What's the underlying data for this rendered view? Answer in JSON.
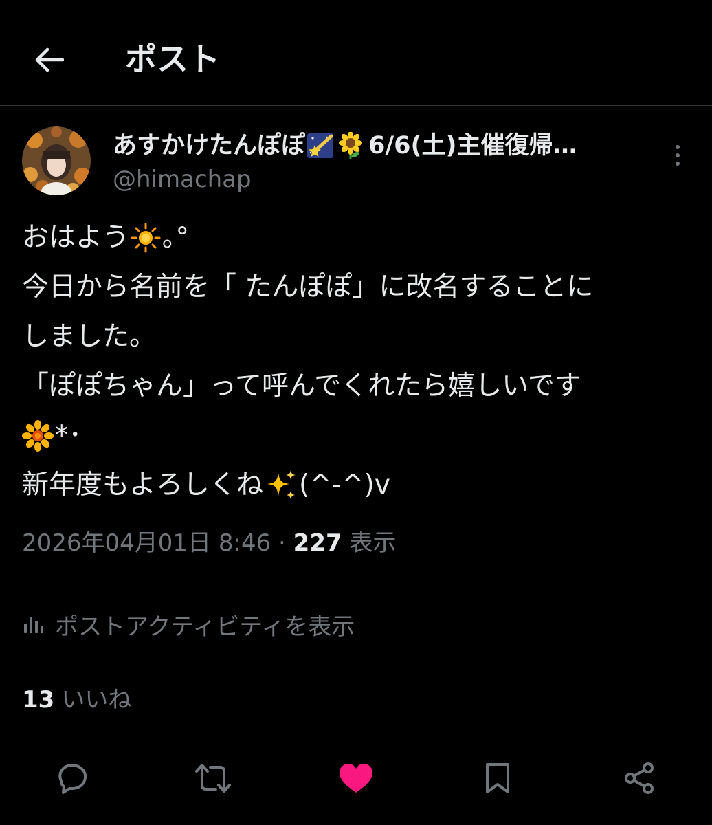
{
  "header": {
    "title": "ポスト",
    "back_icon": "arrow-left-icon"
  },
  "author": {
    "display_name": "あすかけたんぽぽ",
    "display_name_rest": "6/6(土)主催復帰…",
    "handle": "@himachap",
    "name_emojis": [
      "shooting-star-emoji",
      "sunflower-emoji"
    ]
  },
  "post": {
    "lines": [
      "おはよう",
      "今日から名前を「 たんぽぽ」に改名することに",
      "しました。",
      "「ぽぽちゃん」って呼んでくれたら嬉しいです",
      "*･",
      "新年度もよろしくね",
      "(^-^)v"
    ],
    "line1_suffix": "｡°",
    "emojis": [
      "sun-emoji",
      "blossom-emoji",
      "sparkles-emoji"
    ]
  },
  "meta": {
    "timestamp": "2026年04月01日 8:46",
    "separator": "·",
    "views_count": "227",
    "views_label": "表示"
  },
  "activity": {
    "label": "ポストアクティビティを表示",
    "icon": "analytics-icon"
  },
  "likes": {
    "count": "13",
    "label": "いいね"
  },
  "actions": {
    "reply_icon": "reply-icon",
    "repost_icon": "repost-icon",
    "like_icon": "heart-icon",
    "bookmark_icon": "bookmark-icon",
    "share_icon": "share-icon",
    "like_color": "#f91880"
  },
  "colors": {
    "background": "#000000",
    "text": "#e7e9ea",
    "secondary": "#71767b",
    "divider": "#2f3336"
  }
}
